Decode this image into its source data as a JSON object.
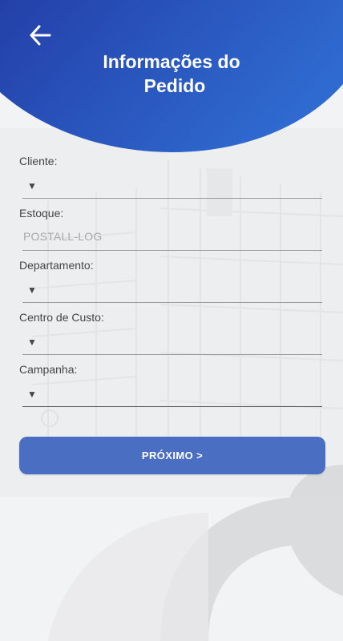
{
  "header": {
    "title_line1": "Informações do",
    "title_line2": "Pedido",
    "back_icon": "arrow-left-icon"
  },
  "form": {
    "fields": [
      {
        "label": "Cliente:",
        "type": "select",
        "value": "",
        "caret": "▼"
      },
      {
        "label": "Estoque:",
        "type": "input",
        "value": "POSTALL-LOG"
      },
      {
        "label": "Departamento:",
        "type": "select",
        "value": "",
        "caret": "▼"
      },
      {
        "label": "Centro de Custo:",
        "type": "select",
        "value": "",
        "caret": "▼"
      },
      {
        "label": "Campanha:",
        "type": "select",
        "value": "",
        "caret": "▼"
      }
    ]
  },
  "next_button": {
    "label": "PRÓXIMO >"
  },
  "colors": {
    "header_gradient_start": "#2340a8",
    "header_gradient_end": "#2f6ad0",
    "button": "#4a6fc2",
    "background": "#f3f4f5"
  }
}
